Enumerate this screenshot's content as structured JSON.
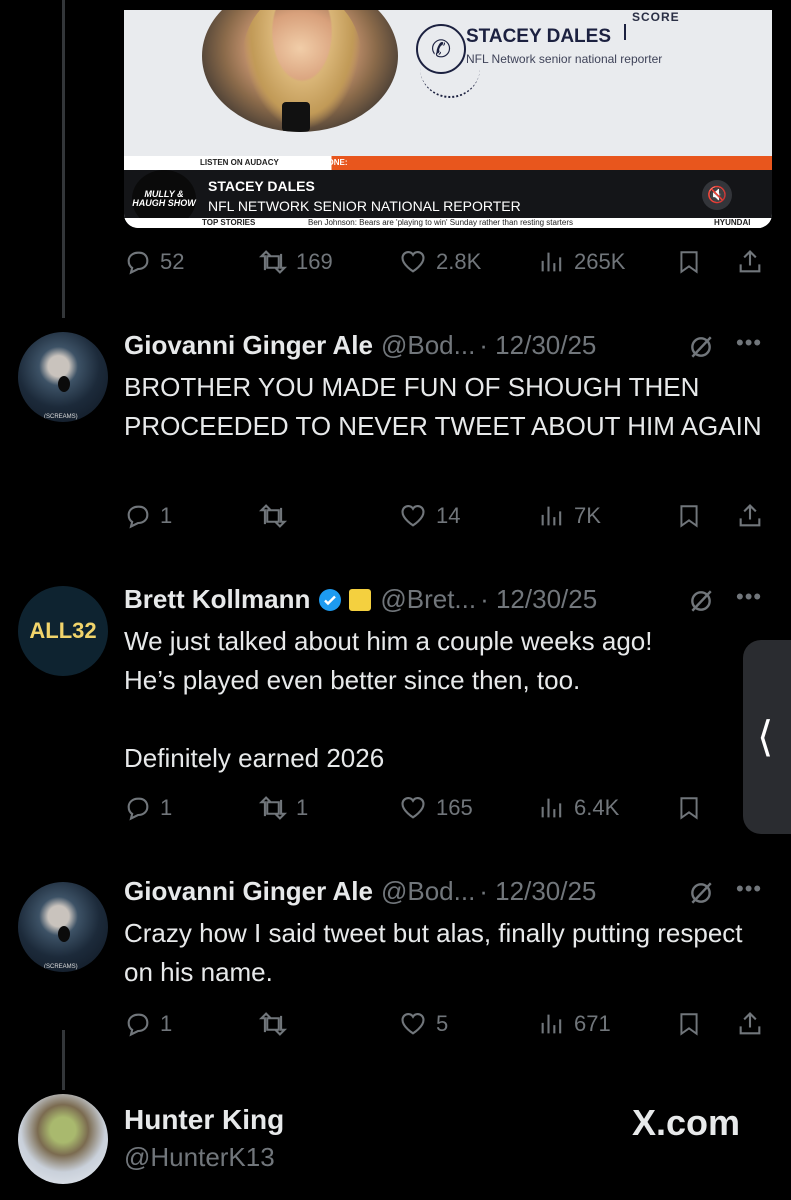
{
  "media": {
    "logo_score": "SCORE",
    "guest_name": "STACEY DALES",
    "guest_role": "NFL Network senior national reporter",
    "listen_label": "LISTEN ON AUDACY",
    "on_phone_label": "ON THE PHONE:",
    "show_logo": "MULLY & HAUGH SHOW",
    "lower_name": "STACEY DALES",
    "lower_role": "NFL NETWORK SENIOR NATIONAL REPORTER",
    "ticker_label": "TOP STORIES",
    "ticker_text": "Ben Johnson: Bears are 'playing to win' Sunday rather than resting starters",
    "ticker_sponsor": "HYUNDAI"
  },
  "tweet0_stats": {
    "replies": "52",
    "reposts": "169",
    "likes": "2.8K",
    "views": "265K"
  },
  "tweets": [
    {
      "name": "Giovanni Ginger Ale",
      "handle": "@Bod...",
      "date": "· 12/30/25",
      "body": "BROTHER YOU MADE FUN OF SHOUGH THEN PROCEEDED TO NEVER TWEET ABOUT HIM AGAIN",
      "avatar_tag": "(SCREAMS)",
      "replies": "1",
      "reposts": "",
      "likes": "14",
      "views": "7K"
    },
    {
      "name": "Brett Kollmann",
      "handle": "@Bret...",
      "date": "· 12/30/25",
      "body": "We just talked about him a couple weeks ago!\nHe’s played even better since then, too.\n\nDefinitely earned 2026",
      "avatar_text": "ALL32",
      "replies": "1",
      "reposts": "1",
      "likes": "165",
      "views": "6.4K"
    },
    {
      "name": "Giovanni Ginger Ale",
      "handle": "@Bod...",
      "date": "· 12/30/25",
      "body": "Crazy how I said tweet but alas, finally putting respect on his name.",
      "avatar_tag": "(SCREAMS)",
      "replies": "1",
      "reposts": "",
      "likes": "5",
      "views": "671"
    }
  ],
  "footer": {
    "name": "Hunter King",
    "handle": "@HunterK13",
    "site": "X.com"
  },
  "icons": {
    "reply": "reply-icon",
    "repost": "repost-icon",
    "like": "heart-icon",
    "views": "views-icon",
    "bookmark": "bookmark-icon",
    "share": "share-icon",
    "grok": "grok-icon",
    "more": "more-icon",
    "verified": "verified-badge-icon"
  },
  "colors": {
    "background": "#000000",
    "text": "#e7e9ea",
    "muted": "#71767b",
    "verified": "#1d9bf0",
    "accent_orange": "#e8561d"
  }
}
